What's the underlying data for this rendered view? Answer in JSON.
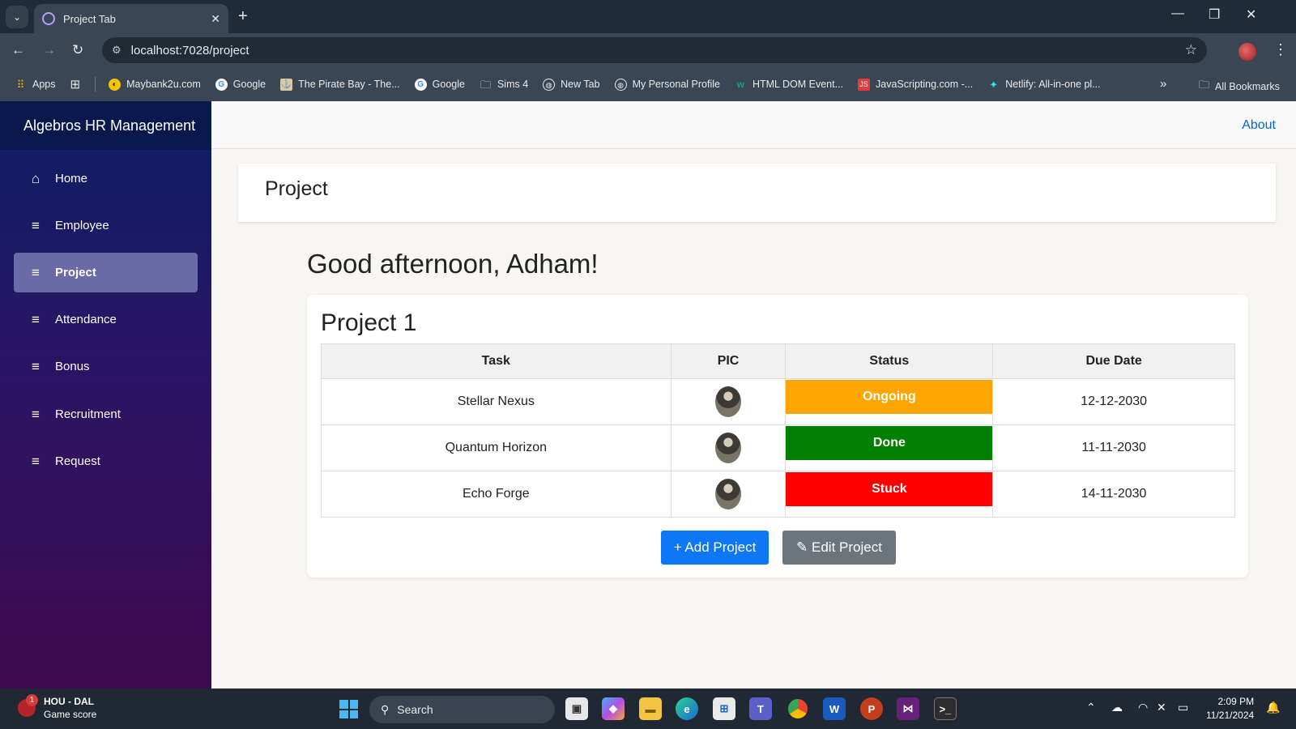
{
  "browser": {
    "tab_title": "Project Tab",
    "url": "localhost:7028/project",
    "bookmarks": [
      {
        "label": "Apps",
        "icon": "apps-grid-icon",
        "color": "#f4b400"
      },
      {
        "label": "Maybank2u.com",
        "icon": "maybank-icon",
        "color": "#f5c400"
      },
      {
        "label": "Google",
        "icon": "google-icon",
        "color": "#ffffff"
      },
      {
        "label": "The Pirate Bay - The...",
        "icon": "pirate-bay-icon",
        "color": "#d9c7a5"
      },
      {
        "label": "Google",
        "icon": "google-icon",
        "color": "#ffffff"
      },
      {
        "label": "Sims 4",
        "icon": "folder-icon",
        "color": "#e8eaed"
      },
      {
        "label": "New Tab",
        "icon": "globe-icon",
        "color": "#e8eaed"
      },
      {
        "label": "My Personal Profile",
        "icon": "globe-icon",
        "color": "#e8eaed"
      },
      {
        "label": "HTML DOM Event...",
        "icon": "w3schools-icon",
        "color": "#04aa6d"
      },
      {
        "label": "JavaScripting.com -...",
        "icon": "javascripting-icon",
        "color": "#e23b3b"
      },
      {
        "label": "Netlify: All-in-one pl...",
        "icon": "netlify-icon",
        "color": "#32e6e2"
      }
    ],
    "all_bookmarks": "All Bookmarks"
  },
  "app": {
    "brand": "Algebros HR Management",
    "nav": [
      {
        "label": "Home",
        "icon": "home-icon",
        "active": false
      },
      {
        "label": "Employee",
        "icon": "list-icon",
        "active": false
      },
      {
        "label": "Project",
        "icon": "list-icon",
        "active": true
      },
      {
        "label": "Attendance",
        "icon": "list-icon",
        "active": false
      },
      {
        "label": "Bonus",
        "icon": "list-icon",
        "active": false
      },
      {
        "label": "Recruitment",
        "icon": "list-icon",
        "active": false
      },
      {
        "label": "Request",
        "icon": "list-icon",
        "active": false
      }
    ],
    "about": "About",
    "page_title": "Project",
    "greeting": "Good afternoon, Adham!",
    "project": {
      "title": "Project 1",
      "columns": [
        "Task",
        "PIC",
        "Status",
        "Due Date"
      ],
      "rows": [
        {
          "task": "Stellar Nexus",
          "status": "Ongoing",
          "status_color": "#ffa500",
          "due": "12-12-2030"
        },
        {
          "task": "Quantum Horizon",
          "status": "Done",
          "status_color": "#008000",
          "due": "11-11-2030"
        },
        {
          "task": "Echo Forge",
          "status": "Stuck",
          "status_color": "#ff0000",
          "due": "14-11-2030"
        }
      ],
      "add_label": "+ Add Project",
      "edit_label": "✎ Edit Project"
    }
  },
  "taskbar": {
    "widget_title": "HOU - DAL",
    "widget_subtitle": "Game score",
    "widget_badge": "1",
    "search_placeholder": "Search",
    "time": "2:09 PM",
    "date": "11/21/2024"
  }
}
